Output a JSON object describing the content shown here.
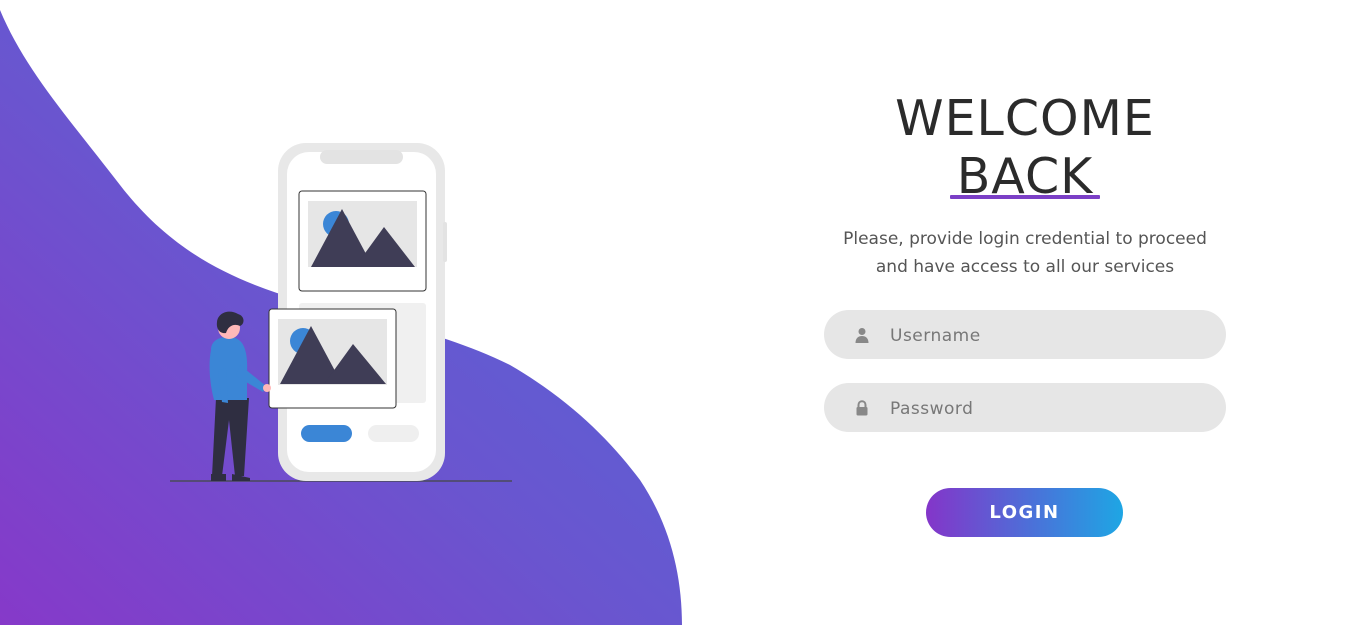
{
  "hero": {
    "background_gradient": [
      "#5b61d6",
      "#7d3fc7"
    ],
    "illustration": "person-with-phone-gallery-illustration"
  },
  "login": {
    "title_line1": "WELCOME",
    "title_line2": "BACK",
    "accent_color": "#7b3fc6",
    "subtitle_line1": "Please, provide login credential to proceed",
    "subtitle_line2": "and have access to all our services",
    "username": {
      "placeholder": "Username",
      "value": "",
      "icon": "user-icon"
    },
    "password": {
      "placeholder": "Password",
      "value": "",
      "icon": "lock-icon"
    },
    "button_label": "LOGIN",
    "button_gradient": [
      "#8435c9",
      "#1ea6e4"
    ]
  }
}
